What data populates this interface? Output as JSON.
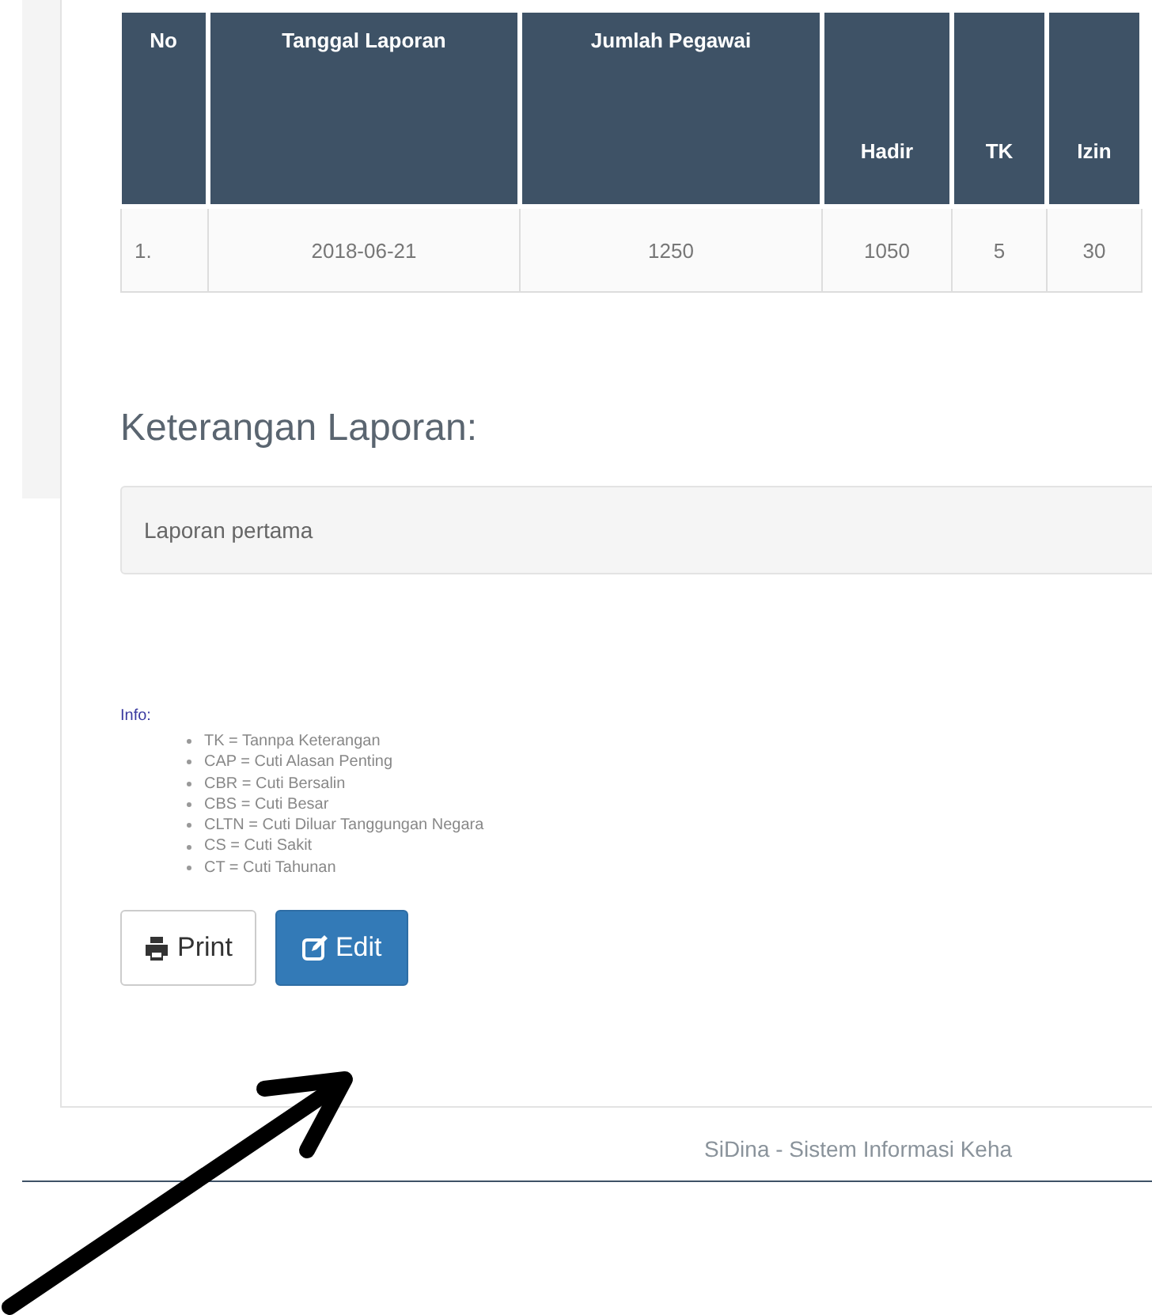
{
  "table": {
    "columns": [
      {
        "label": "No",
        "kind": "spanning"
      },
      {
        "label": "Tanggal Laporan",
        "kind": "spanning"
      },
      {
        "label": "Jumlah Pegawai",
        "kind": "spanning"
      },
      {
        "label": "Hadir",
        "kind": "sub"
      },
      {
        "label": "TK",
        "kind": "sub"
      },
      {
        "label": "Izin",
        "kind": "sub"
      }
    ],
    "rows": [
      [
        "1.",
        "2018-06-21",
        "1250",
        "1050",
        "5",
        "30"
      ]
    ]
  },
  "notes": {
    "heading": "Keterangan Laporan:",
    "text": "Laporan pertama"
  },
  "info": {
    "label": "Info:",
    "items": [
      "TK = Tannpa Keterangan",
      "CAP = Cuti Alasan Penting",
      "CBR = Cuti Bersalin",
      "CBS = Cuti Besar",
      "CLTN = Cuti Diluar Tanggungan Negara",
      "CS = Cuti Sakit",
      "CT = Cuti Tahunan"
    ]
  },
  "buttons": [
    {
      "label": "Print",
      "kind": "print"
    },
    {
      "label": "Edit",
      "kind": "edit"
    }
  ],
  "footer": "SiDina - Sistem Informasi Keha"
}
